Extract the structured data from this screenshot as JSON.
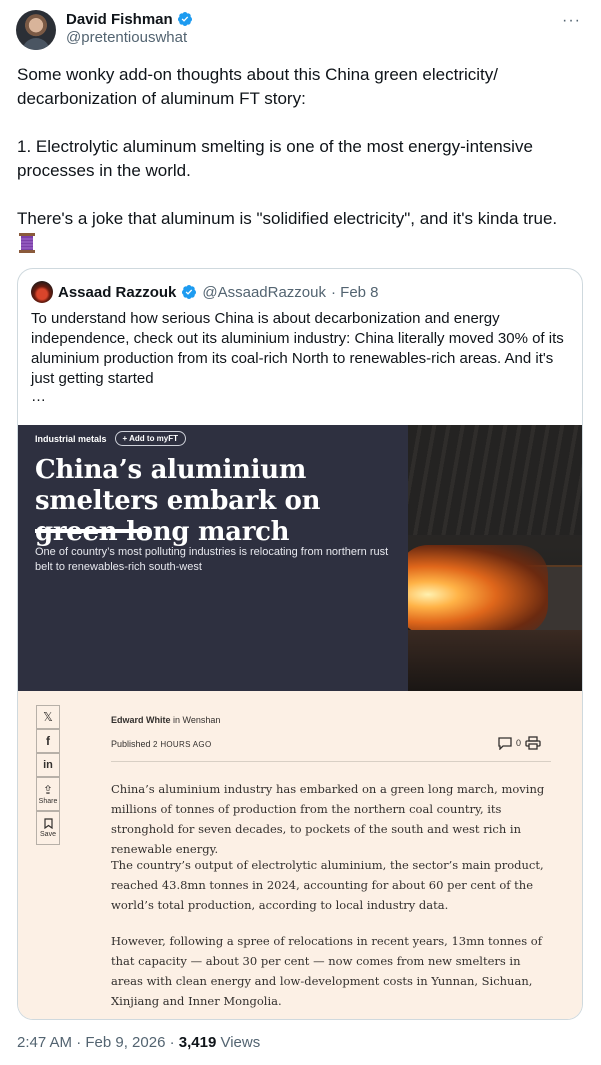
{
  "author": {
    "name": "David Fishman",
    "handle": "@pretentiouswhat"
  },
  "more_label": "···",
  "tweet": {
    "text": "Some wonky add-on thoughts about this China green electricity/\ndecarbonization of aluminum FT story:\n\n1. Electrolytic aluminum smelting is one of the most energy-intensive\nprocesses in the world.\n\nThere's a joke that aluminum is \"solidified electricity\", and it's kinda true.",
    "emoji_icon": "spool-of-thread-icon"
  },
  "quote": {
    "name": "Assaad Razzouk",
    "handle": "@AssaadRazzouk",
    "date": "· Feb 8",
    "text": "To understand how serious China is about decarbonization and energy independence, check out its aluminium industry: China literally moved 30% of its aluminium production from its coal-rich North to renewables-rich areas. And it's just getting started",
    "ellipsis": "…"
  },
  "ft": {
    "section": "Industrial metals",
    "add_label": "+ Add to myFT",
    "headline": "China’s aluminium smelters embark on green long march",
    "standfirst": "One of country’s most polluting industries is relocating from northern rust belt to renewables-rich south-west",
    "byline_author": "Edward White",
    "byline_location": "in Wenshan",
    "published_label": "Published",
    "published_time": "2 HOURS AGO",
    "comment_count": "0",
    "share_buttons": [
      {
        "glyph": "𝕏",
        "label": ""
      },
      {
        "glyph": "f",
        "label": ""
      },
      {
        "glyph": "in",
        "label": ""
      },
      {
        "glyph": "⇪",
        "label": "Share"
      },
      {
        "glyph": "🔖",
        "label": "Save"
      }
    ],
    "paragraphs": [
      "China’s aluminium industry has embarked on a green long march, moving millions of tonnes of production from the northern coal country, its stronghold for seven decades, to pockets of the south and west rich in renewable energy.",
      "The country’s output of electrolytic aluminium, the sector’s main product, reached 43.8mn tonnes in 2024, accounting for about 60 per cent of the world’s total production, according to local industry data.",
      "However, following a spree of relocations in recent years, 13mn tonnes of that capacity — about 30 per cent — now comes from new smelters in areas with clean energy and low-development costs in Yunnan, Sichuan, Xinjiang and Inner Mongolia."
    ]
  },
  "meta": {
    "time": "2:47 AM · Feb 9, 2026 ·",
    "views_count": "3,419",
    "views_label": "Views"
  },
  "colors": {
    "verified": "#1d9bf0",
    "ft_dark": "#2e3040",
    "ft_paper": "#fcf0e5"
  }
}
